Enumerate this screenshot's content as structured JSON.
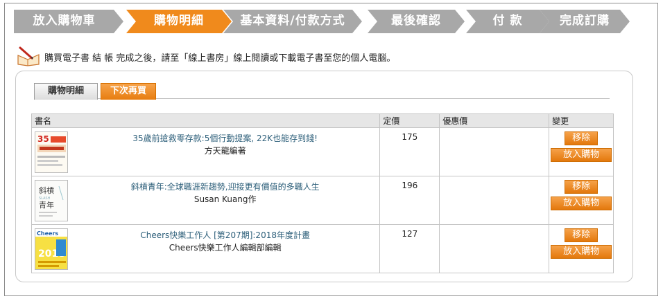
{
  "steps": [
    {
      "label": "放入購物車",
      "state": "done"
    },
    {
      "label": "購物明細",
      "state": "active"
    },
    {
      "label": "基本資料/付款方式",
      "state": "todo"
    },
    {
      "label": "最後確認",
      "state": "todo"
    },
    {
      "label": "付 款",
      "state": "todo"
    },
    {
      "label": "完成訂購",
      "state": "todo"
    }
  ],
  "colors": {
    "step_active": "#f08a1c",
    "step_inactive": "#a8a8a8",
    "accent": "#e77d10",
    "title_link": "#2d5f7a"
  },
  "notice": {
    "icon": "book-pen-icon",
    "text": "購買電子書 結 帳 完成之後，請至「線上書房」線上閱讀或下載電子書至您的個人電腦。"
  },
  "tabs": {
    "cart_detail": "購物明細",
    "buy_later": "下次再買"
  },
  "table": {
    "headers": {
      "name": "書名",
      "price": "定價",
      "discount": "優惠價",
      "change": "變更"
    },
    "rows": [
      {
        "title": "35歲前搶救零存款:5個行動提案, 22K也能存到錢!",
        "author": "方天龍編著",
        "price": "175",
        "discount": "",
        "remove": "移除",
        "add_cart": "放入購物",
        "cover_icon": "book-cover-savings"
      },
      {
        "title": "斜槓青年:全球職涯新趨勢,迎接更有價值的多職人生",
        "author": "Susan Kuang作",
        "price": "196",
        "discount": "",
        "remove": "移除",
        "add_cart": "放入購物",
        "cover_icon": "book-cover-slash"
      },
      {
        "title": "Cheers快樂工作人 [第207期]:2018年度計畫",
        "author": "Cheers快樂工作人編輯部編輯",
        "price": "127",
        "discount": "",
        "remove": "移除",
        "add_cart": "放入購物",
        "cover_icon": "book-cover-cheers"
      }
    ]
  },
  "covers": {
    "slash_title_line1": "斜槓",
    "slash_title_line2": "青年",
    "slash_sub": "SLASH",
    "cheers_brand": "Cheers",
    "cheers_year": "2018"
  }
}
